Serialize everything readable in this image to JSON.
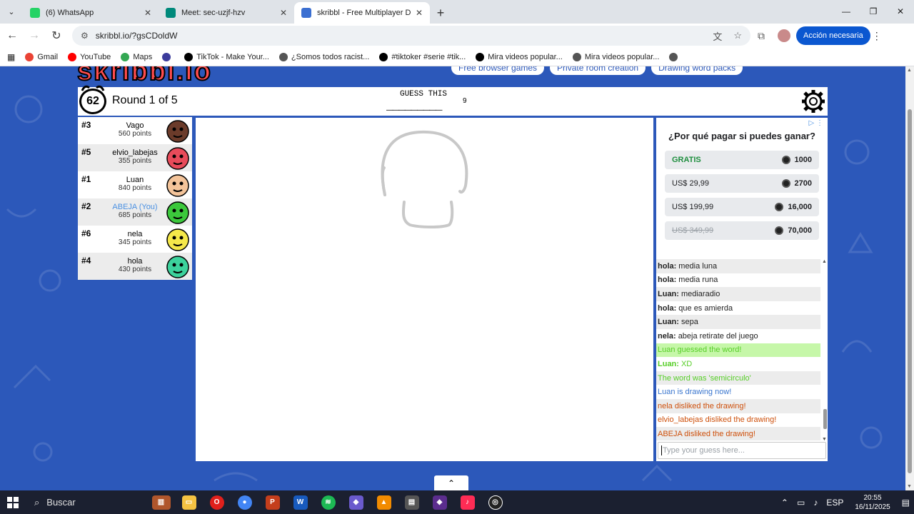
{
  "browser": {
    "tabs": [
      {
        "title": "(6) WhatsApp",
        "color": "#25d366",
        "active": false
      },
      {
        "title": "Meet: sec-uzjf-hzv",
        "color": "#00897b",
        "active": false
      },
      {
        "title": "skribbl - Free Multiplayer Drawi",
        "color": "#3b6fd1",
        "active": true
      }
    ],
    "url": "skribbl.io/?gsCDoldW",
    "action_label": "Acción necesaria",
    "bookmarks": [
      {
        "label": "Gmail",
        "color": "#ea4335"
      },
      {
        "label": "YouTube",
        "color": "#ff0000"
      },
      {
        "label": "Maps",
        "color": "#34a853"
      },
      {
        "label": "",
        "color": "#3c3c9c"
      },
      {
        "label": "TikTok - Make Your...",
        "color": "#000000"
      },
      {
        "label": "¿Somos todos racist...",
        "color": "#555555"
      },
      {
        "label": "#tiktoker #serie #tik...",
        "color": "#000000"
      },
      {
        "label": "Mira videos popular...",
        "color": "#000000"
      },
      {
        "label": "Mira videos popular...",
        "color": "#555555"
      },
      {
        "label": "",
        "color": "#555555"
      }
    ]
  },
  "game": {
    "top_links": [
      "Free browser games",
      "Private room creation",
      "Drawing word packs"
    ],
    "timer": "62",
    "round": "Round 1 of 5",
    "guess_label": "GUESS THIS",
    "word_blanks": "_________",
    "word_length": "9",
    "players": [
      {
        "rank": "#3",
        "name": "Vago",
        "points": "560 points",
        "you": false,
        "color": "#6b3b2a"
      },
      {
        "rank": "#5",
        "name": "elvio_labejas",
        "points": "355 points",
        "you": false,
        "color": "#e84b5a"
      },
      {
        "rank": "#1",
        "name": "Luan",
        "points": "840 points",
        "you": false,
        "color": "#f4c49a"
      },
      {
        "rank": "#2",
        "name": "ABEJA (You)",
        "points": "685 points",
        "you": true,
        "color": "#3cc83c"
      },
      {
        "rank": "#6",
        "name": "nela",
        "points": "345 points",
        "you": false,
        "color": "#f5e84a"
      },
      {
        "rank": "#4",
        "name": "hola",
        "points": "430 points",
        "you": false,
        "color": "#3cd29c"
      }
    ]
  },
  "ad": {
    "mark": "▷ ⋮",
    "title": "¿Por qué pagar si puedes ganar?",
    "offers": [
      {
        "label": "GRATIS",
        "amount": "1000",
        "style": "green"
      },
      {
        "label": "US$ 29,99",
        "amount": "2700",
        "style": ""
      },
      {
        "label": "US$ 199,99",
        "amount": "16,000",
        "style": ""
      },
      {
        "label": "US$ 349,99",
        "amount": "70,000",
        "style": "strike"
      }
    ]
  },
  "chat": [
    {
      "who": "hola:",
      "text": "media luna",
      "kind": "msg"
    },
    {
      "who": "hola:",
      "text": "media runa",
      "kind": "msg"
    },
    {
      "who": "Luan:",
      "text": "mediaradio",
      "kind": "msg"
    },
    {
      "who": "hola:",
      "text": "que es amierda",
      "kind": "msg"
    },
    {
      "who": "Luan:",
      "text": "sepa",
      "kind": "msg"
    },
    {
      "who": "nela:",
      "text": "abeja retirate del juego",
      "kind": "msg"
    },
    {
      "who": "",
      "text": "Luan guessed the word!",
      "kind": "guessed"
    },
    {
      "who": "Luan:",
      "text": "XD",
      "kind": "greentxt"
    },
    {
      "who": "",
      "text": "The word was 'semicirculo'",
      "kind": "greentxt"
    },
    {
      "who": "",
      "text": "Luan is drawing now!",
      "kind": "drawing"
    },
    {
      "who": "",
      "text": "nela disliked the drawing!",
      "kind": "dislike"
    },
    {
      "who": "",
      "text": "elvio_labejas disliked the drawing!",
      "kind": "dislike"
    },
    {
      "who": "",
      "text": "ABEJA disliked the drawing!",
      "kind": "dislike"
    }
  ],
  "guess_placeholder": "Type your guess here...",
  "taskbar": {
    "search": "Buscar",
    "lang": "ESP",
    "time": "20:55",
    "date": "16/11/2025"
  }
}
